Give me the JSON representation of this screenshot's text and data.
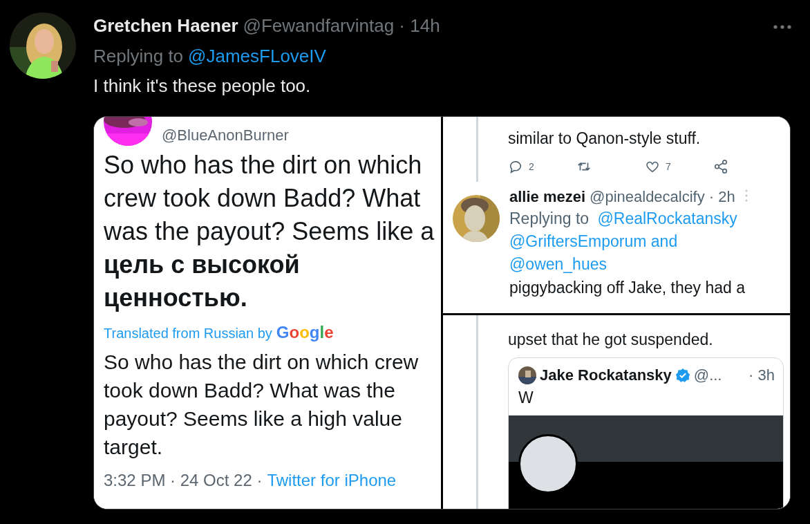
{
  "tweet": {
    "author_name": "Gretchen Haener",
    "handle_time": "@Fewandfarvintag · 14h",
    "replying_label": "Replying to",
    "replying_to": "@JamesFLoveIV",
    "text": "I think it's these people too."
  },
  "media": {
    "left": {
      "handle": "@BlueAnonBurner",
      "original_text": "So who has the dirt on which crew took down Badd? What was the payout? Seems like a **цель с высокой ценностью.**",
      "translation_label": "Translated from Russian by",
      "translator": "Google",
      "translated_text": "So who has the dirt on which crew took down Badd? What was the payout? Seems like a high value target.",
      "timestamp": "3:32 PM · 24 Oct 22 ·",
      "source": "Twitter for iPhone"
    },
    "right_top": {
      "previous_text": "similar to Qanon-style stuff.",
      "actions": [
        {
          "kind": "reply",
          "count": "2"
        },
        {
          "kind": "retweet"
        },
        {
          "kind": "like",
          "count": "7"
        },
        {
          "kind": "share"
        }
      ],
      "reply": {
        "name": "allie mezei",
        "handle_time": "@pinealdecalcify · 2h",
        "replying_label": "Replying to",
        "mentions": [
          "@RealRockatansky",
          "@GriftersEmporum and",
          "@owen_hues"
        ],
        "text": "piggybacking off Jake, they had a"
      }
    },
    "right_bottom": {
      "text": "upset that he got suspended.",
      "quote": {
        "name": "Jake Rockatansky",
        "verified": true,
        "handle": "@...",
        "time": "· 3h",
        "text": "W"
      }
    }
  }
}
